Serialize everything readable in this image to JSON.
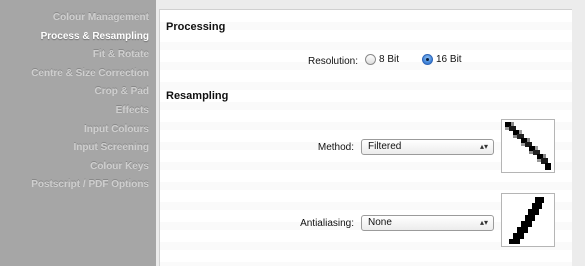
{
  "sidebar": {
    "items": [
      {
        "label": "Colour Management",
        "active": false
      },
      {
        "label": "Process & Resampling",
        "active": true
      },
      {
        "label": "Fit & Rotate",
        "active": false
      },
      {
        "label": "Centre & Size Correction",
        "active": false
      },
      {
        "label": "Crop & Pad",
        "active": false
      },
      {
        "label": "Effects",
        "active": false
      },
      {
        "label": "Input Colours",
        "active": false
      },
      {
        "label": "Input Screening",
        "active": false
      },
      {
        "label": "Colour Keys",
        "active": false
      },
      {
        "label": "Postscript / PDF Options",
        "active": false
      }
    ]
  },
  "processing": {
    "title": "Processing",
    "resolution_label": "Resolution:",
    "options": [
      {
        "label": "8 Bit",
        "selected": false
      },
      {
        "label": "16 Bit",
        "selected": true
      }
    ]
  },
  "resampling": {
    "title": "Resampling",
    "method_label": "Method:",
    "method_value": "Filtered",
    "antialiasing_label": "Antialiasing:",
    "antialiasing_value": "None"
  },
  "colors": {
    "sidebar_bg": "#a6a6a6",
    "accent": "#3a7fd6"
  }
}
